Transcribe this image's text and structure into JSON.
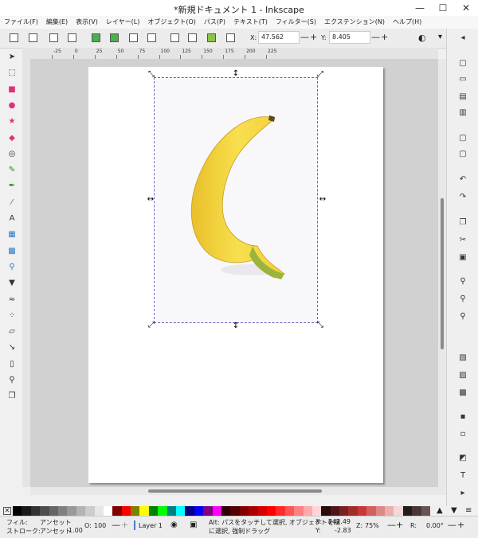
{
  "window": {
    "title": "*新規ドキュメント 1 - Inkscape",
    "min_glyph": "—",
    "max_glyph": "☐",
    "close_glyph": "✕"
  },
  "menu": [
    "ファイル(F)",
    "編集(E)",
    "表示(V)",
    "レイヤー(L)",
    "オブジェクト(O)",
    "パス(P)",
    "テキスト(T)",
    "フィルター(S)",
    "エクステンション(N)",
    "ヘルプ(H)"
  ],
  "controls": {
    "x_label": "X:",
    "x_value": "47.562",
    "y_label": "Y:",
    "y_value": "8.405",
    "minus": "—",
    "plus": "+"
  },
  "ruler": {
    "labels": [
      "-25",
      "0",
      "25",
      "50",
      "75",
      "100",
      "125",
      "150",
      "175",
      "200",
      "225"
    ]
  },
  "icons": {
    "tools": [
      "selector-icon",
      "node-icon",
      "rect-icon",
      "circle-icon",
      "star-icon",
      "3dbox-icon",
      "spiral-icon",
      "pencil-icon",
      "pen-icon",
      "calligraphy-icon",
      "text-icon",
      "gradient-icon",
      "mesh-icon",
      "dropper-icon",
      "bucket-icon",
      "tweak-icon",
      "spray-icon",
      "eraser-icon",
      "connector-icon",
      "measure-icon",
      "zoom-icon",
      "pages-icon"
    ],
    "commands": [
      "new-doc-icon",
      "open-icon",
      "save-icon",
      "print-icon",
      "import-icon",
      "export-icon",
      "undo-icon",
      "redo-icon",
      "copy-icon",
      "cut-icon",
      "paste-icon",
      "zoom-selection-icon",
      "zoom-drawing-icon",
      "zoom-page-icon",
      "duplicate-icon",
      "clone-icon",
      "unlink-clone-icon",
      "group-icon",
      "ungroup-icon",
      "fill-stroke-icon",
      "text-font-icon",
      "xml-editor-icon"
    ]
  },
  "palette": {
    "colors": [
      "#000000",
      "#1a1a1a",
      "#333333",
      "#4d4d4d",
      "#666666",
      "#808080",
      "#999999",
      "#b3b3b3",
      "#cccccc",
      "#e6e6e6",
      "#ffffff",
      "#800000",
      "#ff0000",
      "#808000",
      "#ffff00",
      "#008000",
      "#00ff00",
      "#008080",
      "#00ffff",
      "#000080",
      "#0000ff",
      "#800080",
      "#ff00ff",
      "#2b0000",
      "#550000",
      "#800000",
      "#aa0000",
      "#d40000",
      "#ff0000",
      "#ff2a2a",
      "#ff5555",
      "#ff8080",
      "#ffaaaa",
      "#ffd5d5",
      "#280b0b",
      "#501616",
      "#782121",
      "#a02c2c",
      "#c83737",
      "#d35f5f",
      "#de8787",
      "#e9afaf",
      "#f4d7d7",
      "#241c1c",
      "#483737",
      "#6c5353"
    ]
  },
  "status": {
    "fill_label": "フィル:",
    "fill_value": "アンセット",
    "stroke_label": "ストローク:",
    "stroke_value": "アンセット",
    "stroke_width": "1.00",
    "opacity_label": "O:",
    "opacity_value": "100",
    "layer": "Layer 1",
    "hint_line1": "Alt: パスをタッチして選択, オブジェクトを順",
    "hint_line2": "に選択, 強制ドラッグ",
    "x_label": "X:",
    "x_value": "242.49",
    "y_label": "Y:",
    "y_value": "-2.83",
    "zoom_label": "Z:",
    "zoom_value": "75%",
    "rotation_label": "R:",
    "rotation_value": "0.00°"
  }
}
